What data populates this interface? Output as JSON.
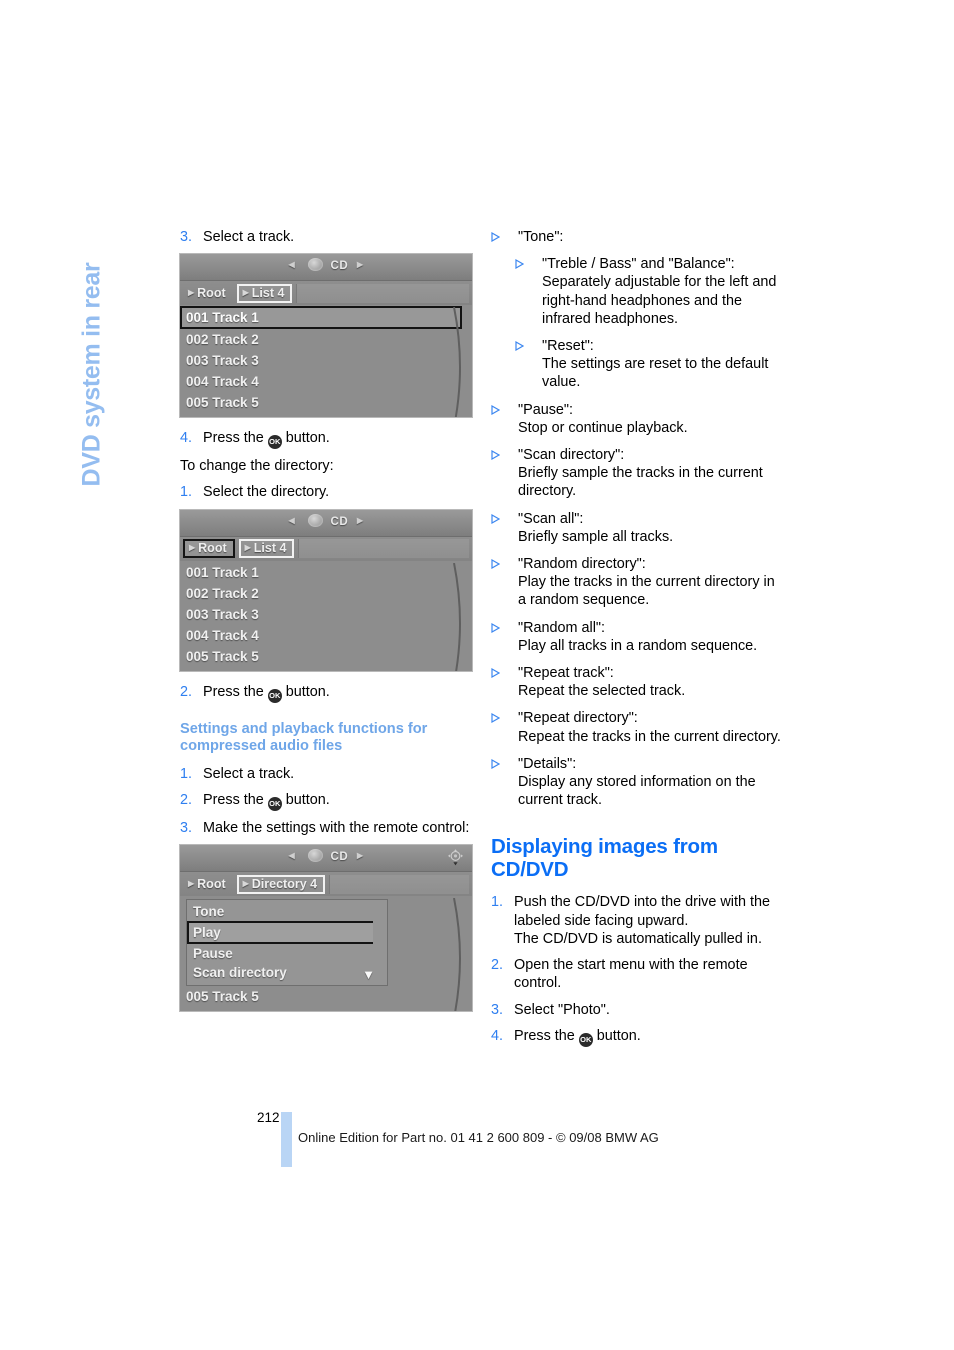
{
  "side_tab": {
    "label": "DVD system in rear"
  },
  "left_column": {
    "step_3": {
      "num": "3.",
      "text": "Select a track."
    },
    "screenshot_1": {
      "source_label": "CD",
      "crumbs": [
        {
          "label": "Root",
          "state": "normal"
        },
        {
          "label": "List 4",
          "state": "selected-light"
        }
      ],
      "rows": [
        {
          "label": "001 Track 1",
          "selected": true
        },
        {
          "label": "002 Track 2",
          "selected": false
        },
        {
          "label": "003 Track 3",
          "selected": false
        },
        {
          "label": "004 Track 4",
          "selected": false
        },
        {
          "label": "005 Track 5",
          "selected": false
        }
      ]
    },
    "step_4": {
      "num": "4.",
      "pre": "Press the",
      "ok": "OK",
      "post": "button."
    },
    "intro_line": "To change the directory:",
    "step_dir_1": {
      "num": "1.",
      "text": "Select the directory."
    },
    "screenshot_2": {
      "source_label": "CD",
      "crumbs": [
        {
          "label": "Root",
          "state": "selected-dark"
        },
        {
          "label": "List 4",
          "state": "selected-light"
        }
      ],
      "rows": [
        {
          "label": "001 Track 1",
          "selected": false
        },
        {
          "label": "002 Track 2",
          "selected": false
        },
        {
          "label": "003 Track 3",
          "selected": false
        },
        {
          "label": "004 Track 4",
          "selected": false
        },
        {
          "label": "005 Track 5",
          "selected": false
        }
      ]
    },
    "step_dir_2": {
      "num": "2.",
      "pre": "Press the",
      "ok": "OK",
      "post": "button."
    },
    "subheading": "Settings and playback functions for compressed audio files",
    "step_s1": {
      "num": "1.",
      "text": "Select a track."
    },
    "step_s2": {
      "num": "2.",
      "pre": "Press the",
      "ok": "OK",
      "post": "button."
    },
    "step_s3": {
      "num": "3.",
      "text": "Make the settings with the remote control:"
    },
    "screenshot_3": {
      "source_label": "CD",
      "joystick_icon": "joystick-icon",
      "crumbs": [
        {
          "label": "Root",
          "state": "normal"
        },
        {
          "label": "Directory 4",
          "state": "selected-light"
        }
      ],
      "menu_rows": [
        {
          "label": "Tone",
          "selected": false,
          "has_down_arrow": false
        },
        {
          "label": "Play",
          "selected": true,
          "has_down_arrow": false
        },
        {
          "label": "Pause",
          "selected": false,
          "has_down_arrow": false
        },
        {
          "label": "Scan directory",
          "selected": false,
          "has_down_arrow": true
        }
      ],
      "footer_row": "005 Track 5"
    }
  },
  "right_column": {
    "bullets": [
      {
        "level": 1,
        "title": "\"Tone\":",
        "body": "",
        "children": [
          {
            "level": 2,
            "title": "\"Treble / Bass\" and \"Balance\":",
            "body": "Separately adjustable for the left and right-hand headphones and the infrared headphones."
          },
          {
            "level": 2,
            "title": "\"Reset\":",
            "body": "The settings are reset to the default value."
          }
        ]
      },
      {
        "level": 1,
        "title": "\"Pause\":",
        "body": "Stop or continue playback."
      },
      {
        "level": 1,
        "title": "\"Scan directory\":",
        "body": "Briefly sample the tracks in the current directory."
      },
      {
        "level": 1,
        "title": "\"Scan all\":",
        "body": "Briefly sample all tracks."
      },
      {
        "level": 1,
        "title": "\"Random directory\":",
        "body": "Play the tracks in the current directory in a random sequence."
      },
      {
        "level": 1,
        "title": "\"Random all\":",
        "body": "Play all tracks in a random sequence."
      },
      {
        "level": 1,
        "title": "\"Repeat track\":",
        "body": "Repeat the selected track."
      },
      {
        "level": 1,
        "title": "\"Repeat directory\":",
        "body": "Repeat the tracks in the current directory."
      },
      {
        "level": 1,
        "title": "\"Details\":",
        "body": "Display any stored information on the current track."
      }
    ],
    "heading": "Displaying images from CD/DVD",
    "steps": [
      {
        "num": "1.",
        "text": "Push the CD/DVD into the drive with the labeled side facing upward.\nThe CD/DVD is automatically pulled in."
      },
      {
        "num": "2.",
        "text": "Open the start menu with the remote control."
      },
      {
        "num": "3.",
        "text": "Select \"Photo\"."
      },
      {
        "num": "4.",
        "pre": "Press the",
        "ok": "OK",
        "post": "button."
      }
    ]
  },
  "footer": {
    "page_number": "212",
    "text": "Online Edition for Part no. 01 41 2 600 809 - © 09/08 BMW AG"
  },
  "colors": {
    "accent_blue": "#0b6ef5",
    "step_blue": "#2f7ff0",
    "subheading_blue": "#6fa6e8",
    "side_tab_blue": "#94bdf0",
    "footer_bar_blue": "#b9d5f5"
  }
}
